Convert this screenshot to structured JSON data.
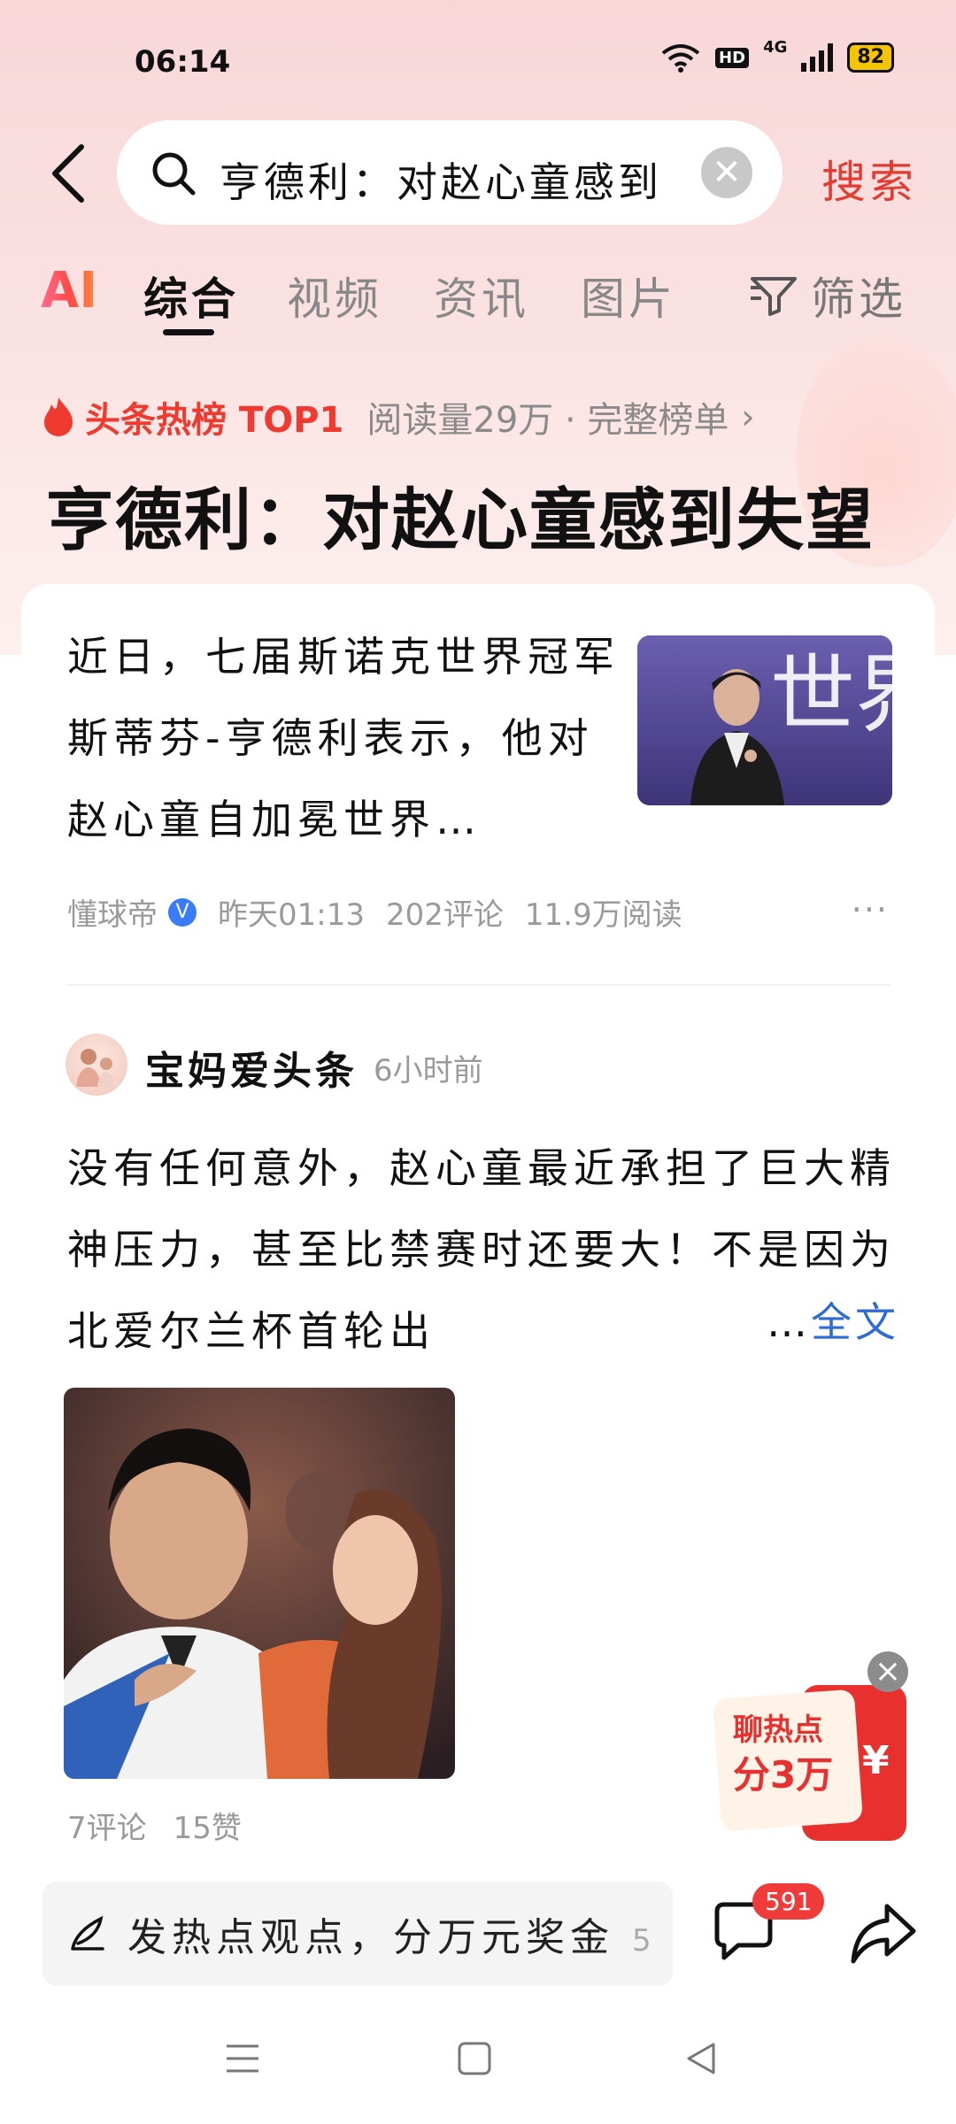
{
  "status_bar": {
    "time": "06:14",
    "network": "4G",
    "hd": "HD",
    "battery": "82"
  },
  "search": {
    "query": "亨德利：对赵心童感到",
    "button_label": "搜索"
  },
  "tabs": {
    "ai": "AI",
    "items": [
      "综合",
      "视频",
      "资讯",
      "图片"
    ],
    "active": "综合",
    "filter": "筛选"
  },
  "hot": {
    "label": "头条热榜 TOP1",
    "meta": "阅读量29万 · 完整榜单",
    "headline": "亨德利：对赵心童感到失望"
  },
  "article": {
    "summary": "近日，七届斯诺克世界冠军斯蒂芬-亨德利表示，他对赵心童自加冕世界…",
    "thumb_text": "世界",
    "source": "懂球帝",
    "verified": "V",
    "time": "昨天01:13",
    "comments": "202评论",
    "reads": "11.9万阅读",
    "more": "···"
  },
  "post": {
    "author": "宝妈爱头条",
    "time": "6小时前",
    "text": "没有任何意外，赵心童最近承担了巨大精神压力，甚至比禁赛时还要大！不是因为北爱尔兰杯首轮出",
    "ellipsis": "…",
    "full_link": "全文",
    "comments": "7评论",
    "likes": "15赞"
  },
  "promo": {
    "line1": "聊热点",
    "line2": "分3万",
    "symbol": "¥"
  },
  "bottom": {
    "comment_placeholder": "发热点观点，分万元奖金",
    "comment_suffix": "5.",
    "comment_count": "591"
  },
  "colors": {
    "accent_red": "#e53a2f",
    "link_blue": "#2f6bd6",
    "badge_red": "#f03b3b"
  }
}
